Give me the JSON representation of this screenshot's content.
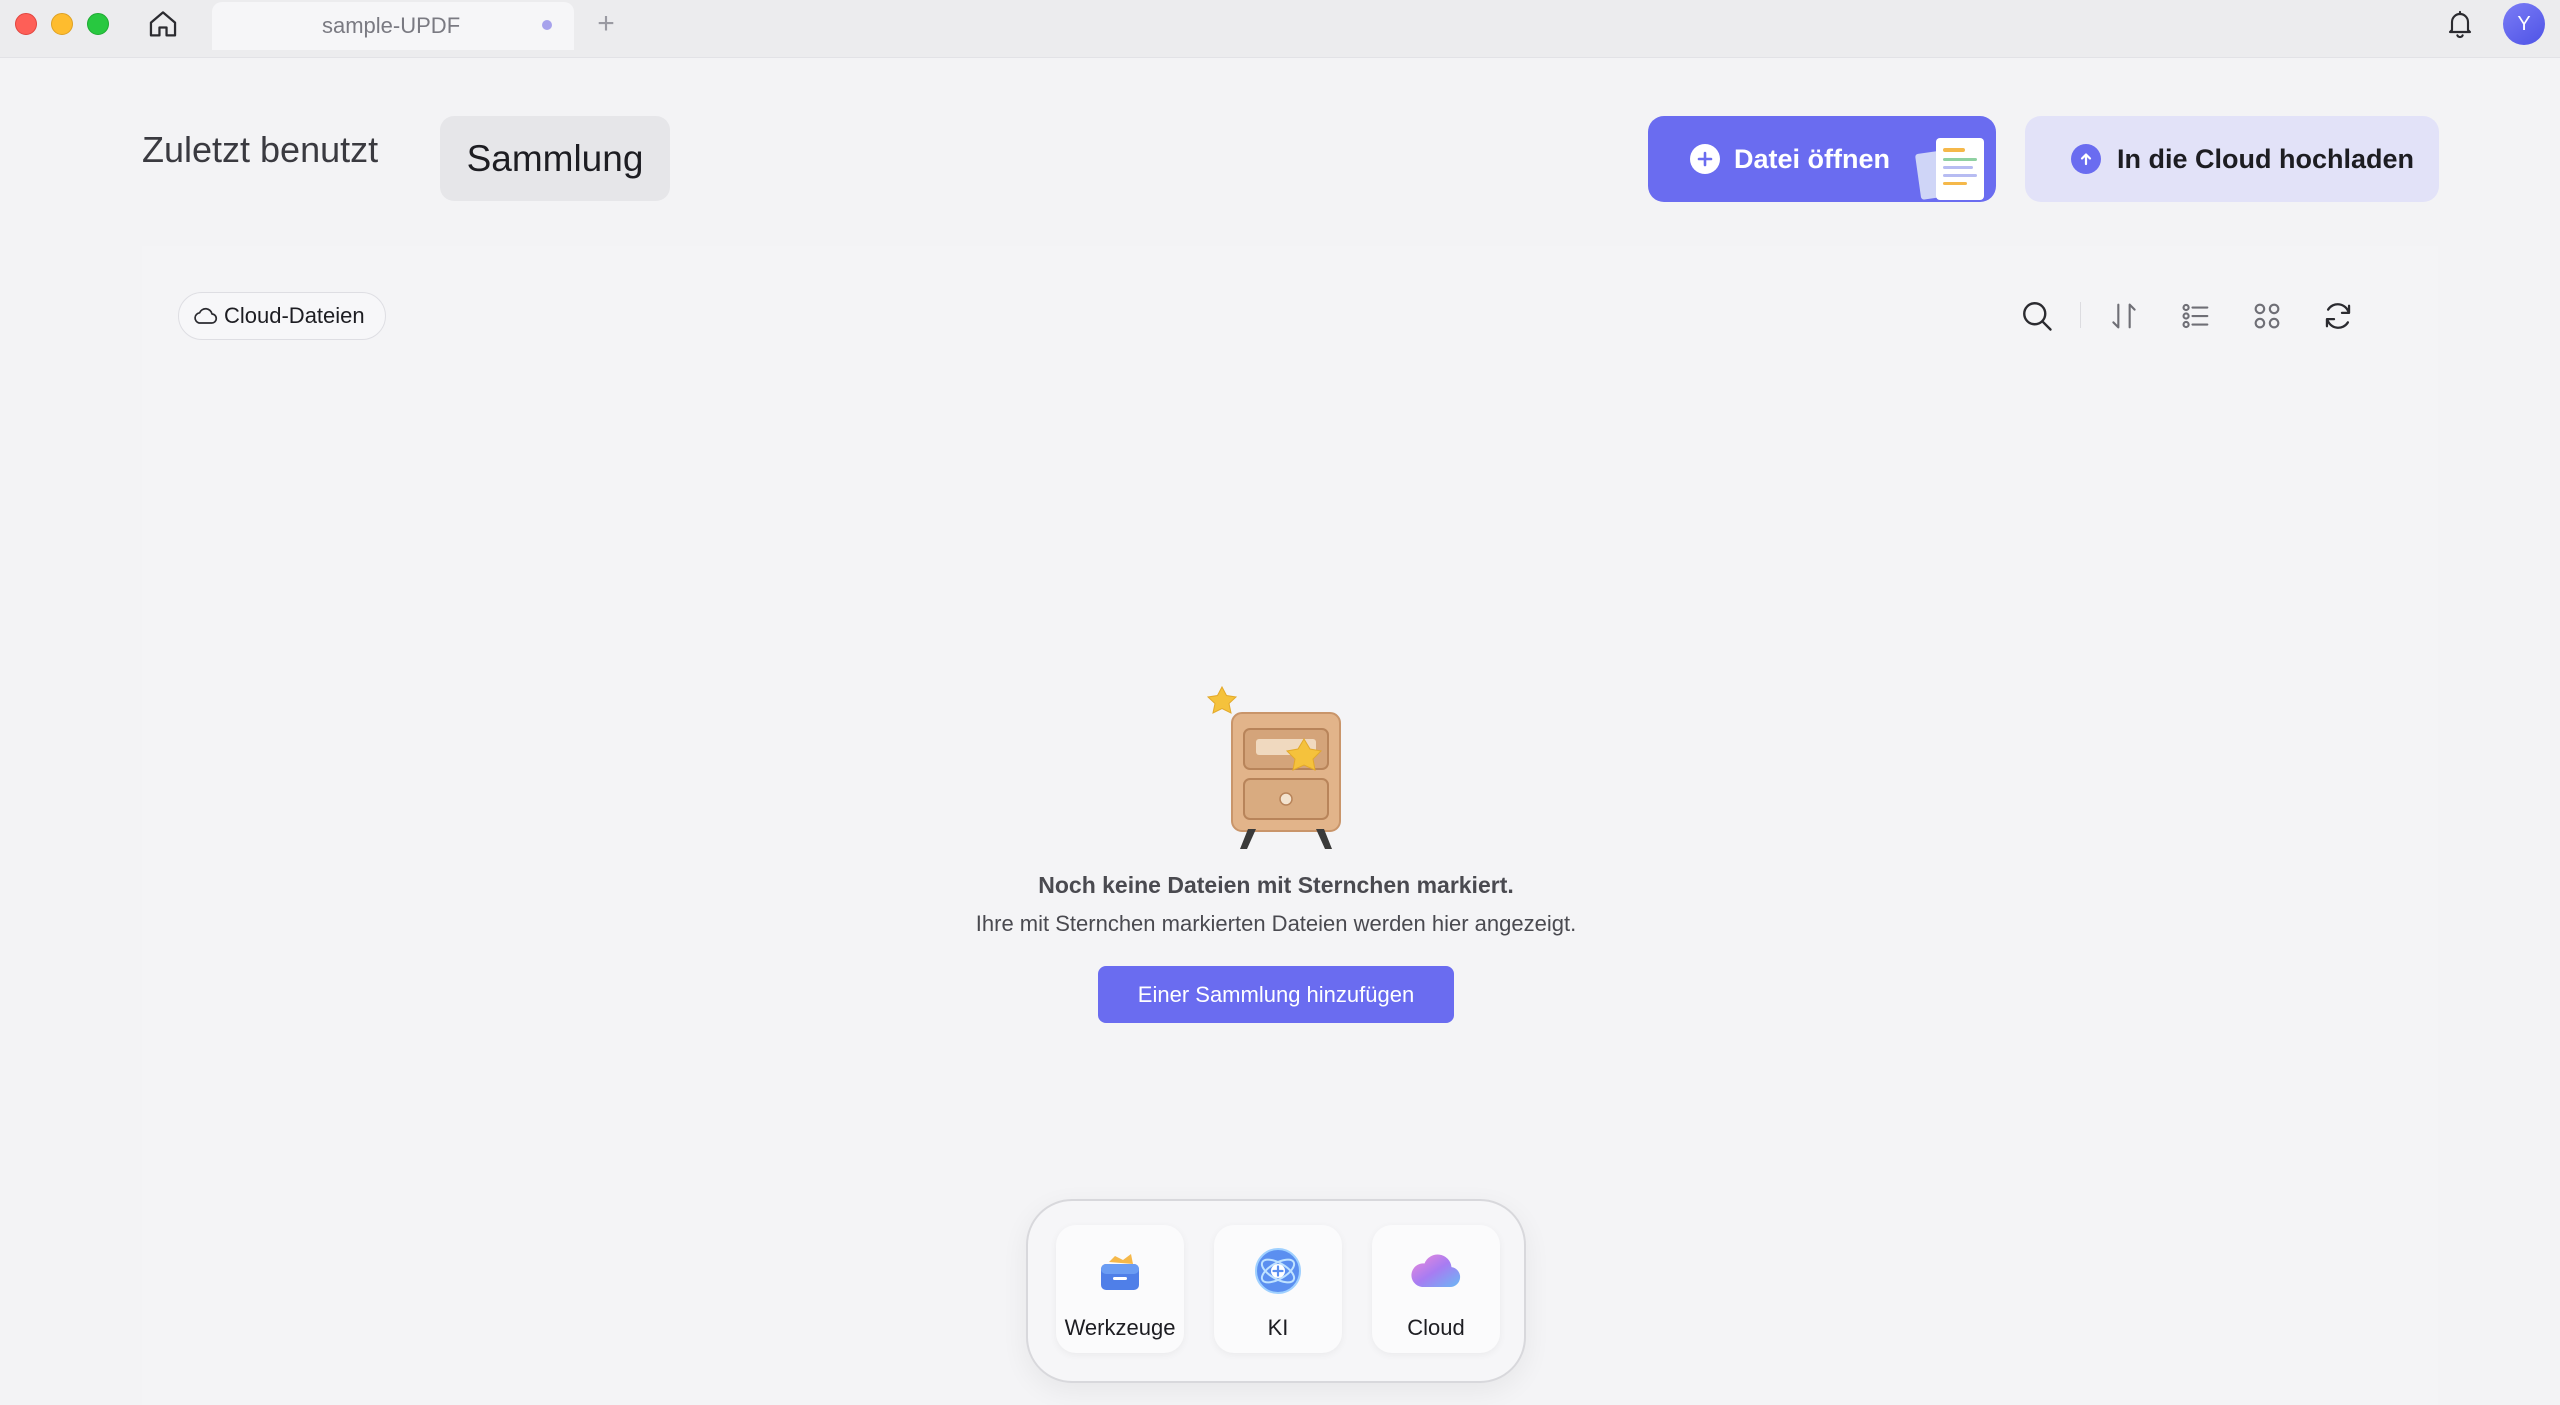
{
  "titlebar": {
    "tab_title": "sample-UPDF",
    "new_tab_symbol": "+",
    "avatar_initial": "Y"
  },
  "header": {
    "nav_recent_label": "Zuletzt benutzt",
    "nav_collection_label": "Sammlung",
    "open_file_label": "Datei öffnen",
    "cloud_upload_label": "In die Cloud hochladen"
  },
  "filter": {
    "cloud_files_label": "Cloud-Dateien"
  },
  "toolbar": {
    "icons": [
      "search-icon",
      "sort-icon",
      "list-view-icon",
      "grid-view-icon",
      "refresh-icon"
    ]
  },
  "empty_state": {
    "title": "Noch keine Dateien mit Sternchen markiert.",
    "subtitle": "Ihre mit Sternchen markierten Dateien werden hier angezeigt.",
    "button_label": "Einer Sammlung hinzufügen"
  },
  "dock": {
    "items": [
      {
        "label": "Werkzeuge",
        "icon": "toolbox-icon"
      },
      {
        "label": "KI",
        "icon": "ai-icon"
      },
      {
        "label": "Cloud",
        "icon": "cloud-icon"
      }
    ]
  },
  "colors": {
    "accent": "#6a6cf0",
    "accent_light": "#e2e2f8",
    "background": "#f3f3f5"
  }
}
